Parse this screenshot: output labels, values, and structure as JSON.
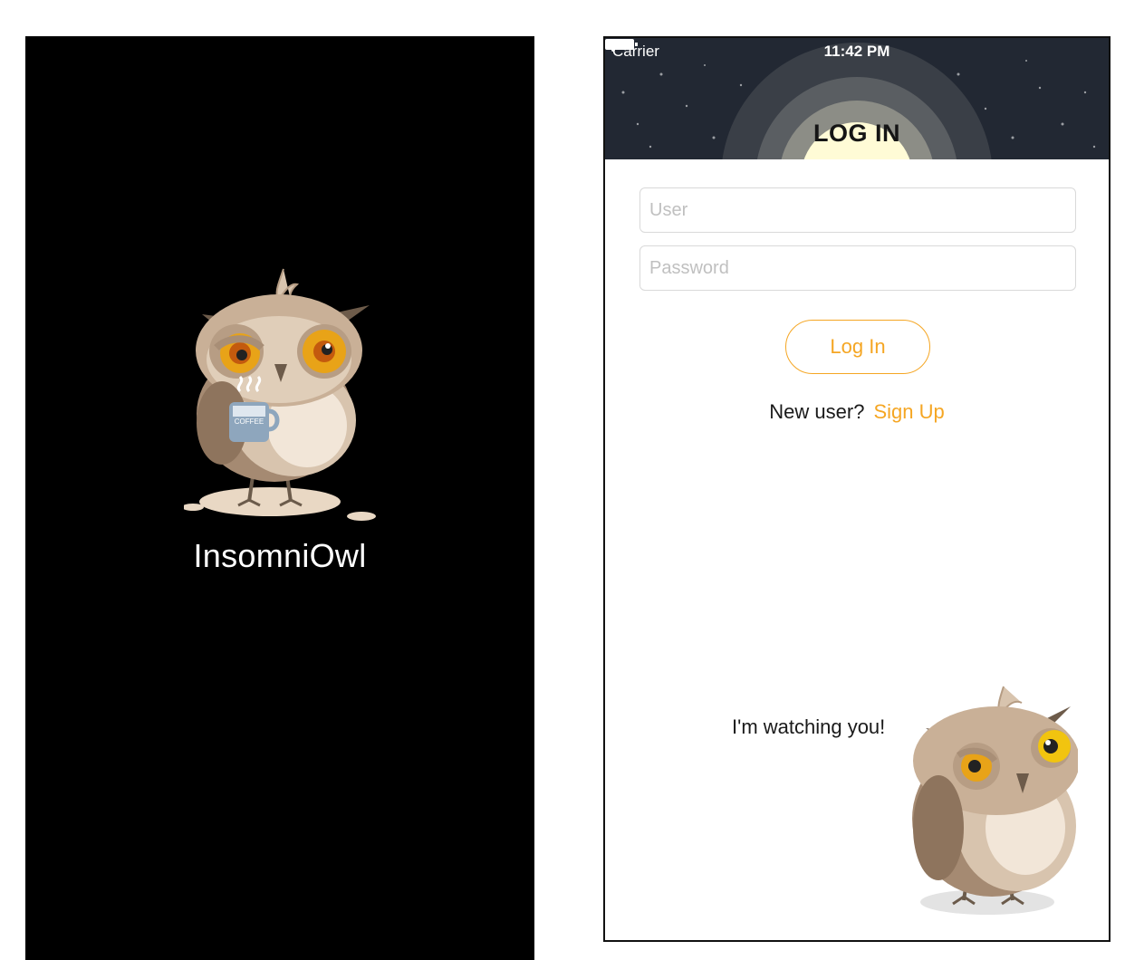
{
  "splash": {
    "app_name": "InsomniOwl"
  },
  "status_bar": {
    "carrier": "Carrier",
    "time": "11:42 PM"
  },
  "header": {
    "title": "LOG IN"
  },
  "form": {
    "user_placeholder": "User",
    "user_value": "",
    "password_placeholder": "Password",
    "password_value": "",
    "login_button": "Log In",
    "new_user_text": "New user?",
    "signup_link": "Sign Up"
  },
  "footer": {
    "owl_caption": "I'm watching you!"
  },
  "colors": {
    "accent": "#f5a623",
    "night_sky": "#222833",
    "moon": "#fffbd6"
  },
  "icons": [
    "wifi-icon",
    "battery-icon",
    "owl-illustration",
    "coffee-mug-icon",
    "stars"
  ]
}
